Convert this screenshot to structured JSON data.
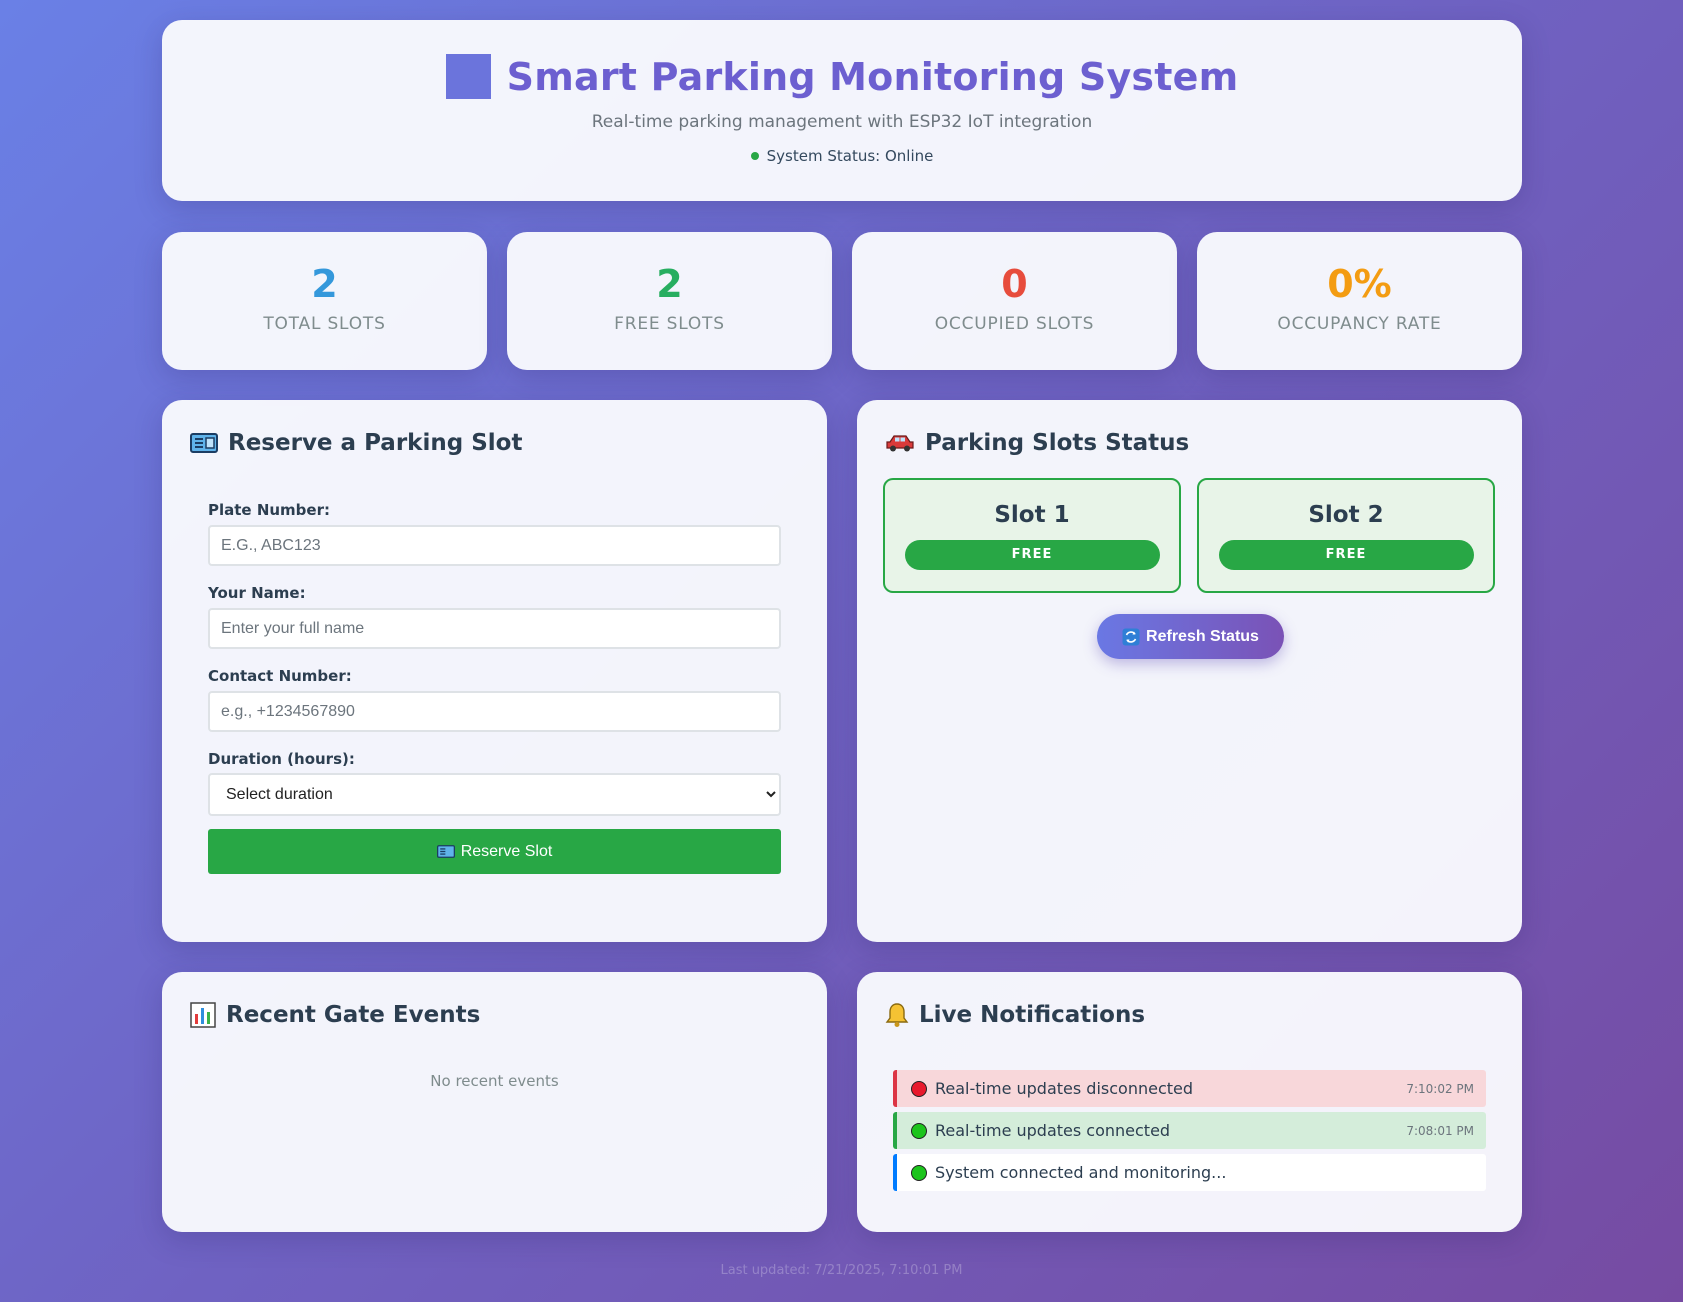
{
  "header": {
    "title": "Smart Parking Monitoring System",
    "subtitle": "Real-time parking management with ESP32 IoT integration",
    "status": "System Status: Online"
  },
  "stats": [
    {
      "value": "2",
      "label": "TOTAL SLOTS",
      "color": "#3498db"
    },
    {
      "value": "2",
      "label": "FREE SLOTS",
      "color": "#27ae60"
    },
    {
      "value": "0",
      "label": "OCCUPIED SLOTS",
      "color": "#e74c3c"
    },
    {
      "value": "0%",
      "label": "OCCUPANCY RATE",
      "color": "#f39c12"
    }
  ],
  "reserve": {
    "title": "Reserve a Parking Slot",
    "icon": "ticket-icon",
    "plate_label": "Plate Number:",
    "plate_placeholder": "E.G., ABC123",
    "name_label": "Your Name:",
    "name_placeholder": "Enter your full name",
    "contact_label": "Contact Number:",
    "contact_placeholder": "e.g., +1234567890",
    "duration_label": "Duration (hours):",
    "duration_selected": "Select duration",
    "button_label": "Reserve Slot"
  },
  "slots": {
    "title": "Parking Slots Status",
    "icon": "car-icon",
    "items": [
      {
        "name": "Slot 1",
        "status": "FREE"
      },
      {
        "name": "Slot 2",
        "status": "FREE"
      }
    ],
    "refresh_label": "Refresh Status"
  },
  "events": {
    "title": "Recent Gate Events",
    "icon": "bar-chart-icon",
    "empty": "No recent events"
  },
  "notifications": {
    "title": "Live Notifications",
    "icon": "bell-icon",
    "items": [
      {
        "text": "Real-time updates disconnected",
        "time": "7:10:02 PM",
        "type": "error",
        "bg": "#f8d7da",
        "border": "#dc3545",
        "dot": "#e8192c"
      },
      {
        "text": "Real-time updates connected",
        "time": "7:08:01 PM",
        "type": "success",
        "bg": "#d4edda",
        "border": "#28a745",
        "dot": "#1cc41c"
      },
      {
        "text": "System connected and monitoring...",
        "time": "",
        "type": "info",
        "bg": "#ffffff",
        "border": "#007bff",
        "dot": "#1cc41c"
      }
    ]
  },
  "footer": {
    "last_updated": "Last updated: 7/21/2025, 7:10:01 PM"
  }
}
